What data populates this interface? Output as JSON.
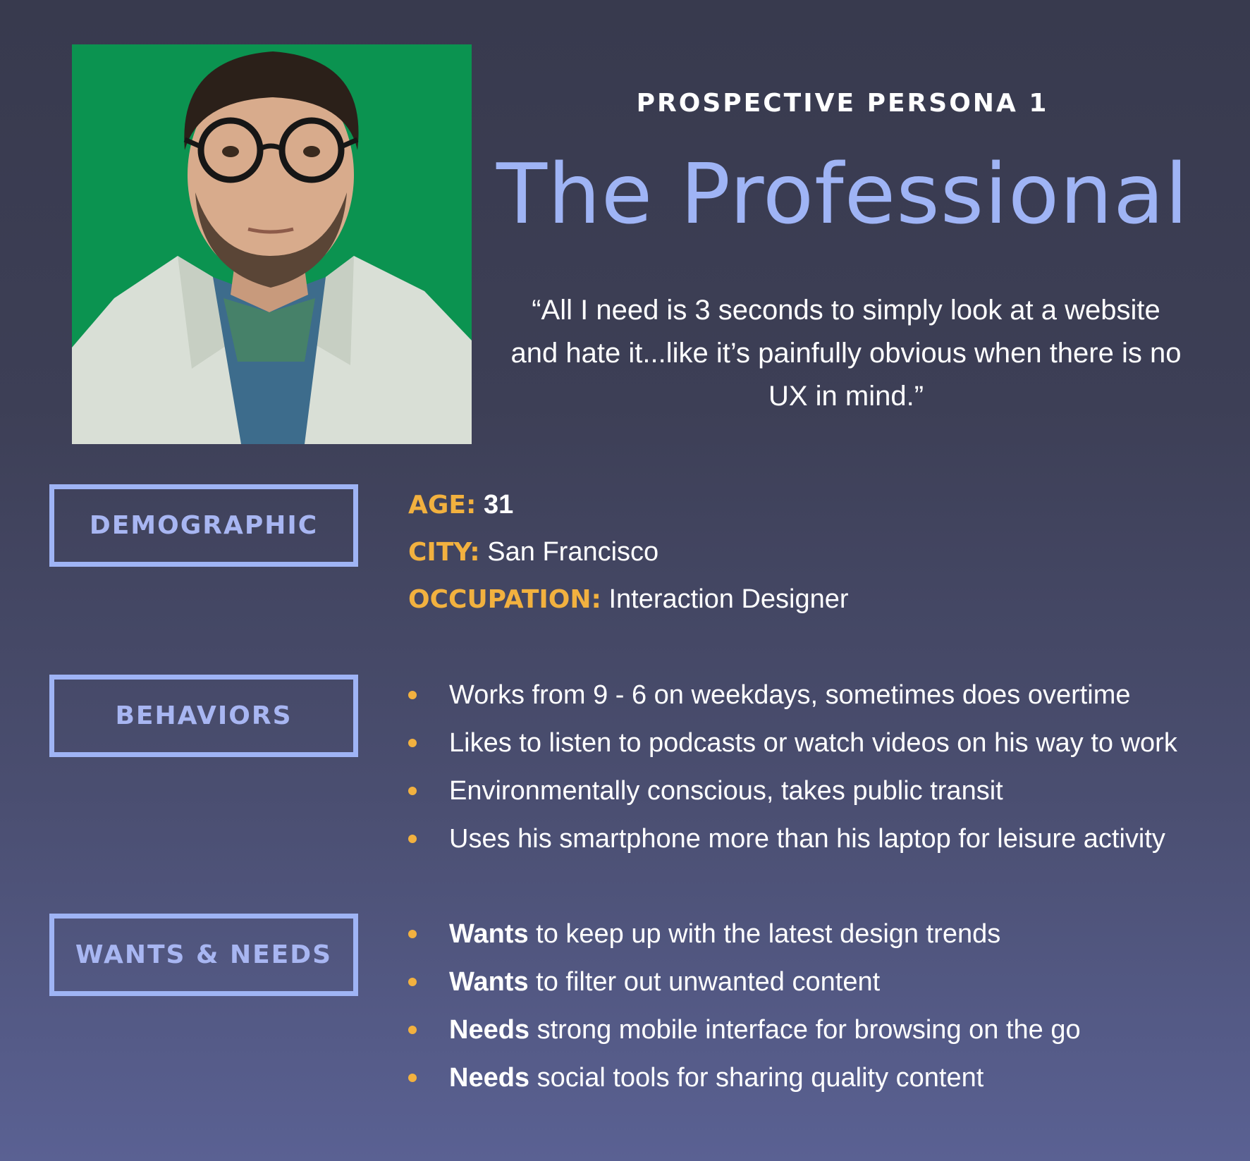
{
  "header": {
    "eyebrow": "PROSPECTIVE PERSONA 1",
    "title": "The Professional",
    "quote": "“All I need is 3 seconds to simply look at a website and hate it...like it’s painfully obvious when there is no UX in mind.”"
  },
  "photo": {
    "icon": "persona-portrait",
    "background_color": "#0b9350"
  },
  "colors": {
    "accent": "#f2b13f",
    "title": "#9fb4f5",
    "label_border": "#9fb4f5"
  },
  "sections": {
    "demographic": {
      "label": "DEMOGRAPHIC",
      "rows": [
        {
          "key": "AGE:",
          "value": "31"
        },
        {
          "key": "CITY:",
          "value": "San Francisco"
        },
        {
          "key": "OCCUPATION:",
          "value": "Interaction Designer"
        }
      ]
    },
    "behaviors": {
      "label": "BEHAVIORS",
      "items": [
        "Works from 9 - 6 on weekdays, sometimes does overtime",
        "Likes to listen to podcasts or watch videos on his way to work",
        "Environmentally conscious, takes public transit",
        "Uses his smartphone more than his laptop for leisure activity"
      ]
    },
    "wants_needs": {
      "label": "WANTS & NEEDS",
      "items": [
        {
          "keyword": "Wants",
          "text": " to keep up with the latest design trends"
        },
        {
          "keyword": "Wants",
          "text": " to filter out unwanted content"
        },
        {
          "keyword": "Needs",
          "text": " strong mobile interface for browsing on the go"
        },
        {
          "keyword": "Needs",
          "text": " social tools for sharing quality content"
        }
      ]
    }
  }
}
